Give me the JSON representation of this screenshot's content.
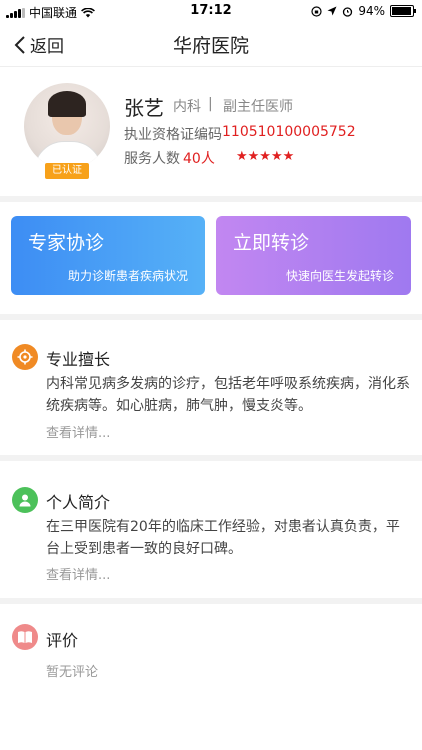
{
  "status_bar": {
    "carrier": "中国联通",
    "time": "17:12",
    "battery": "94%",
    "battery_level": 0.94
  },
  "nav": {
    "back_label": "返回",
    "title": "华府医院"
  },
  "doctor": {
    "name": "张艺",
    "department": "内科",
    "separator": "|",
    "rank": "副主任医师",
    "verified_badge": "已认证",
    "license_label": "执业资格证编码",
    "license_value": "110510100005752",
    "service_label": "服务人数",
    "service_value": "40人",
    "stars": "★★★★★",
    "rating": 5
  },
  "actions": [
    {
      "title": "专家协诊",
      "subtitle": "助力诊断患者疾病状况",
      "color_start": "#3d8df4",
      "color_end": "#56b1f7"
    },
    {
      "title": "立即转诊",
      "subtitle": "快速向医生发起转诊",
      "color_start": "#c287f1",
      "color_end": "#9f79f0"
    }
  ],
  "sections": {
    "specialty": {
      "icon": "target-icon",
      "color": "#f08a24",
      "title": "专业擅长",
      "text": "内科常见病多发病的诊疗，包括老年呼吸系统疾病，消化系统疾病等。如心脏病，肺气肿，慢支炎等。",
      "more": "查看详情..."
    },
    "profile": {
      "icon": "person-icon",
      "color": "#4cc15a",
      "title": "个人简介",
      "text": "在三甲医院有20年的临床工作经验，对患者认真负责，平台上受到患者一致的良好口碑。",
      "more": "查看详情..."
    },
    "reviews": {
      "icon": "book-icon",
      "color": "#ef8a8a",
      "title": "评价",
      "empty": "暂无评论"
    }
  }
}
